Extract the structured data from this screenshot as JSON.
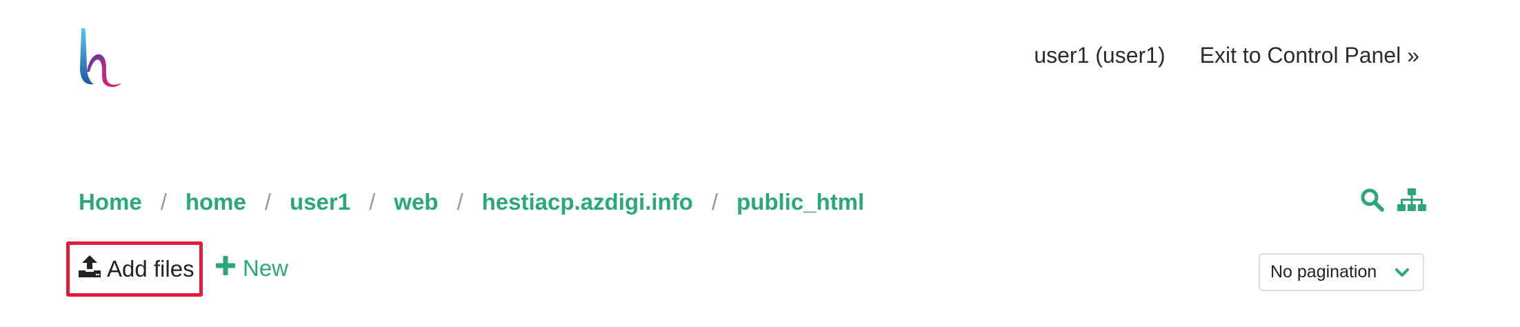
{
  "header": {
    "logo_icon": "hestia-logo",
    "user_label": "user1 (user1)",
    "exit_label": "Exit to Control Panel »"
  },
  "breadcrumb": {
    "items": [
      "Home",
      "home",
      "user1",
      "web",
      "hestiacp.azdigi.info",
      "public_html"
    ],
    "separator": "/"
  },
  "tools": {
    "search_icon": "search-icon",
    "sitemap_icon": "sitemap-icon"
  },
  "actions": {
    "add_files_label": "Add files",
    "add_files_icon": "upload-icon",
    "new_label": "New",
    "new_icon": "plus-icon",
    "pagination_value": "No pagination"
  },
  "colors": {
    "accent": "#2aa876",
    "highlight": "#e31b3b"
  }
}
